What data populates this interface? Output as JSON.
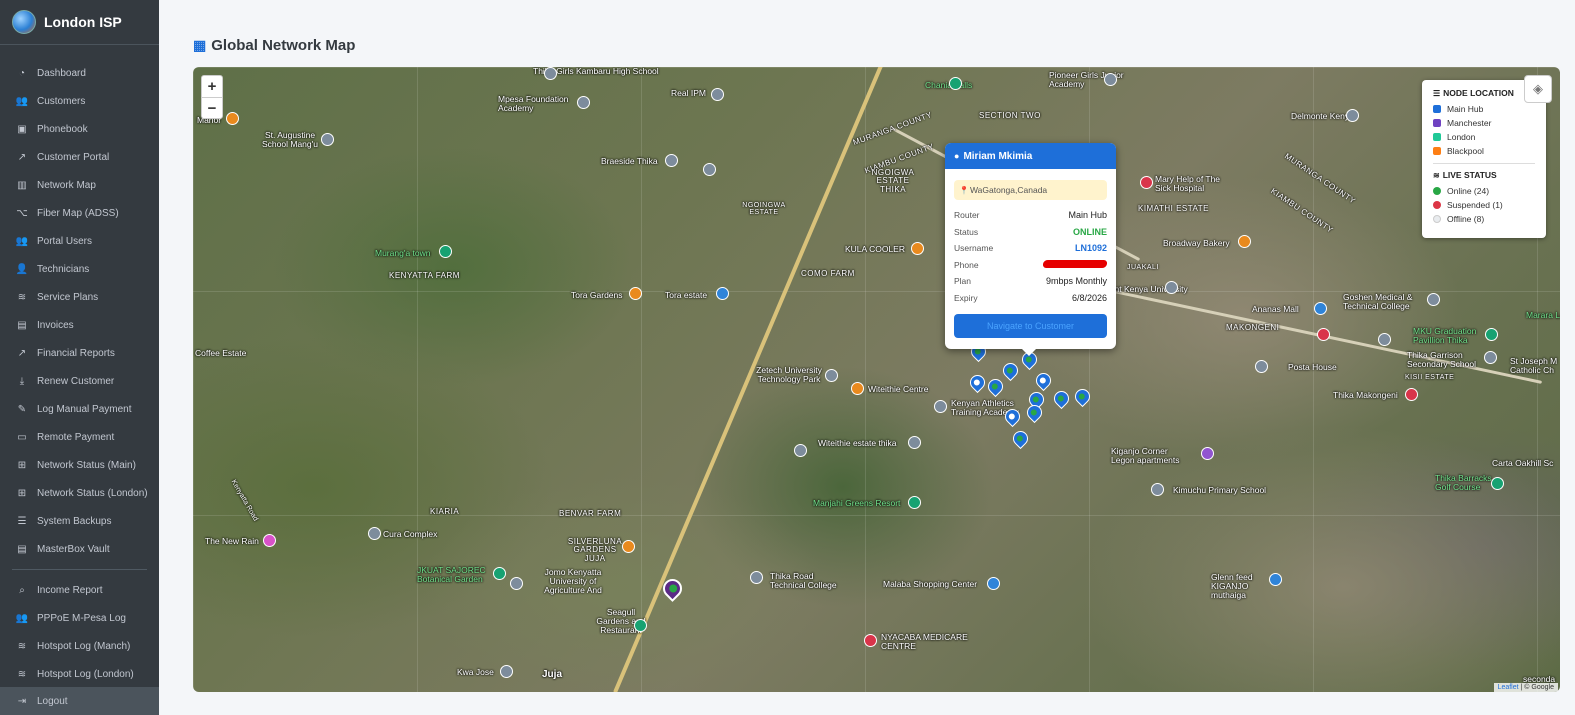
{
  "brand": {
    "name": "London ISP"
  },
  "nav": [
    {
      "label": "Dashboard",
      "icon": "gauge-icon",
      "glyph": "◔"
    },
    {
      "label": "Customers",
      "icon": "users-icon",
      "glyph": "👥"
    },
    {
      "label": "Phonebook",
      "icon": "address-book-icon",
      "glyph": "▣"
    },
    {
      "label": "Customer Portal",
      "icon": "external-link-icon",
      "glyph": "↗"
    },
    {
      "label": "Network Map",
      "icon": "map-icon",
      "glyph": "▥"
    },
    {
      "label": "Fiber Map (ADSS)",
      "icon": "project-diagram-icon",
      "glyph": "⌥"
    },
    {
      "label": "Portal Users",
      "icon": "users-cog-icon",
      "glyph": "👥"
    },
    {
      "label": "Technicians",
      "icon": "user-gear-icon",
      "glyph": "👤"
    },
    {
      "label": "Service Plans",
      "icon": "wifi-icon",
      "glyph": "≋"
    },
    {
      "label": "Invoices",
      "icon": "invoice-icon",
      "glyph": "▤"
    },
    {
      "label": "Financial Reports",
      "icon": "chart-line-icon",
      "glyph": "↗"
    },
    {
      "label": "Renew Customer",
      "icon": "user-refresh-icon",
      "glyph": "⤓"
    },
    {
      "label": "Log Manual Payment",
      "icon": "edit-icon",
      "glyph": "✎"
    },
    {
      "label": "Remote Payment",
      "icon": "credit-card-icon",
      "glyph": "▭"
    },
    {
      "label": "Network Status (Main)",
      "icon": "sitemap-icon",
      "glyph": "⊞"
    },
    {
      "label": "Network Status (London)",
      "icon": "sitemap-icon",
      "glyph": "⊞"
    },
    {
      "label": "System Backups",
      "icon": "server-icon",
      "glyph": "☰"
    },
    {
      "label": "MasterBox Vault",
      "icon": "file-lock-icon",
      "glyph": "▤"
    }
  ],
  "nav2": [
    {
      "label": "Income Report",
      "icon": "search-icon",
      "glyph": "⌕"
    },
    {
      "label": "PPPoE M-Pesa Log",
      "icon": "users-icon",
      "glyph": "👥"
    },
    {
      "label": "Hotspot Log (Manch)",
      "icon": "wifi-icon",
      "glyph": "≋"
    },
    {
      "label": "Hotspot Log (London)",
      "icon": "wifi-icon",
      "glyph": "≋"
    }
  ],
  "logout": {
    "label": "Logout",
    "icon": "logout-icon",
    "glyph": "⇥"
  },
  "page": {
    "title": "Global Network Map",
    "icon": "map-marked-icon"
  },
  "map": {
    "zoom_in": "+",
    "zoom_out": "−",
    "layers_icon": "layers-icon",
    "attribution": {
      "leaflet": "Leaflet",
      "rest": "| © Google"
    },
    "labels": {
      "l1": "Thika Girls Kambaru High School",
      "l2": "Mpesa Foundation Academy",
      "l3": "Real IPM",
      "l4": "Chania Falls",
      "l5": "Pioneer Girls Junior Academy",
      "l6": "Delmonte Kenya",
      "l7": "Manor",
      "l8": "St. Augustine School Mang'u",
      "l9": "Braeside Thika",
      "l10": "MURANGA COUNTY",
      "l11": "SECTION TWO",
      "l12": "KIAMBU COUNTY",
      "l13": "NGOIGWA ESTATE THIKA",
      "l14": "NGOINGWA ESTATE",
      "l15": "Murang'a town",
      "l16": "KENYATTA FARM",
      "l17": "KULA COOLER",
      "l18": "COMO FARM",
      "l19": "Tora Gardens",
      "l20": "Tora estate",
      "l21": "Mary Help of The Sick Hospital",
      "l22": "KIMATHI ESTATE",
      "l23": "Broadway Bakery",
      "l24": "MURANGA COUNTY",
      "l25": "KIAMBU COUNTY",
      "l26": "JUAKALI",
      "l27": "Mount Kenya University",
      "l28": "Ananas Mall",
      "l29": "Goshen Medical & Technical College",
      "l30": "MAKONGENI",
      "l31": "MKU Graduation Pavillion Thika",
      "l32": "Thika Garrison Secondary School",
      "l33": "St Joseph M Catholic Ch",
      "l34": "Coffee Estate",
      "l35": "Zetech University Technology Park",
      "l36": "Witeithie Centre",
      "l37": "Kenyan Athletics Training Academy",
      "l38": "Posta House",
      "l39": "KISII ESTATE",
      "l40": "Thika Makongeni",
      "l41": "Witeithie estate thika",
      "l42": "Kiganjo Corner Legon apartments",
      "l43": "Carta Oakhill Sc",
      "l44": "Kimuchu Primary School",
      "l45": "Thika Barracks Golf Course",
      "l46": "Manjahi Greens Resort",
      "l47": "KIARIA",
      "l48": "BENVAR FARM",
      "l49": "Cura Complex",
      "l50": "The New Rain",
      "l51": "SILVERLUNA GARDENS JUJA",
      "l52": "JKUAT SAJOREC Botanical Garden",
      "l53": "Jomo Kenyatta University of Agriculture And",
      "l54": "Thika Road Technical College",
      "l55": "Malaba Shopping Center",
      "l56": "Glenn feed KIGANJO muthaiga",
      "l57": "Seagull Gardens and Restaurant",
      "l58": "NYACABA MEDICARE CENTRE",
      "l59": "Kwa Jose",
      "l60": "Juja",
      "l61": "Kenyatta Road",
      "l62": "Marara Lan",
      "l63": "seconda"
    }
  },
  "popup": {
    "name": "Miriam Mkimia",
    "location": "WaGatonga,Canada",
    "rows": [
      {
        "k": "Router",
        "v": "Main Hub"
      },
      {
        "k": "Status",
        "v": "ONLINE"
      },
      {
        "k": "Username",
        "v": "LN1092"
      },
      {
        "k": "Phone",
        "v": ""
      },
      {
        "k": "Plan",
        "v": "9mbps Monthly"
      },
      {
        "k": "Expiry",
        "v": "6/8/2026"
      }
    ],
    "button": "Navigate to Customer"
  },
  "legend": {
    "title": "NODE LOCATION",
    "nodes": [
      {
        "label": "Main Hub",
        "color": "#1e6fd9"
      },
      {
        "label": "Manchester",
        "color": "#6f42c1"
      },
      {
        "label": "London",
        "color": "#20c997"
      },
      {
        "label": "Blackpool",
        "color": "#fd7e14"
      }
    ],
    "status_title": "LIVE STATUS",
    "status": [
      {
        "label": "Online (24)",
        "color": "#28a745"
      },
      {
        "label": "Suspended (1)",
        "color": "#dc3545"
      },
      {
        "label": "Offline (8)",
        "color": "#e9ecef"
      }
    ]
  }
}
